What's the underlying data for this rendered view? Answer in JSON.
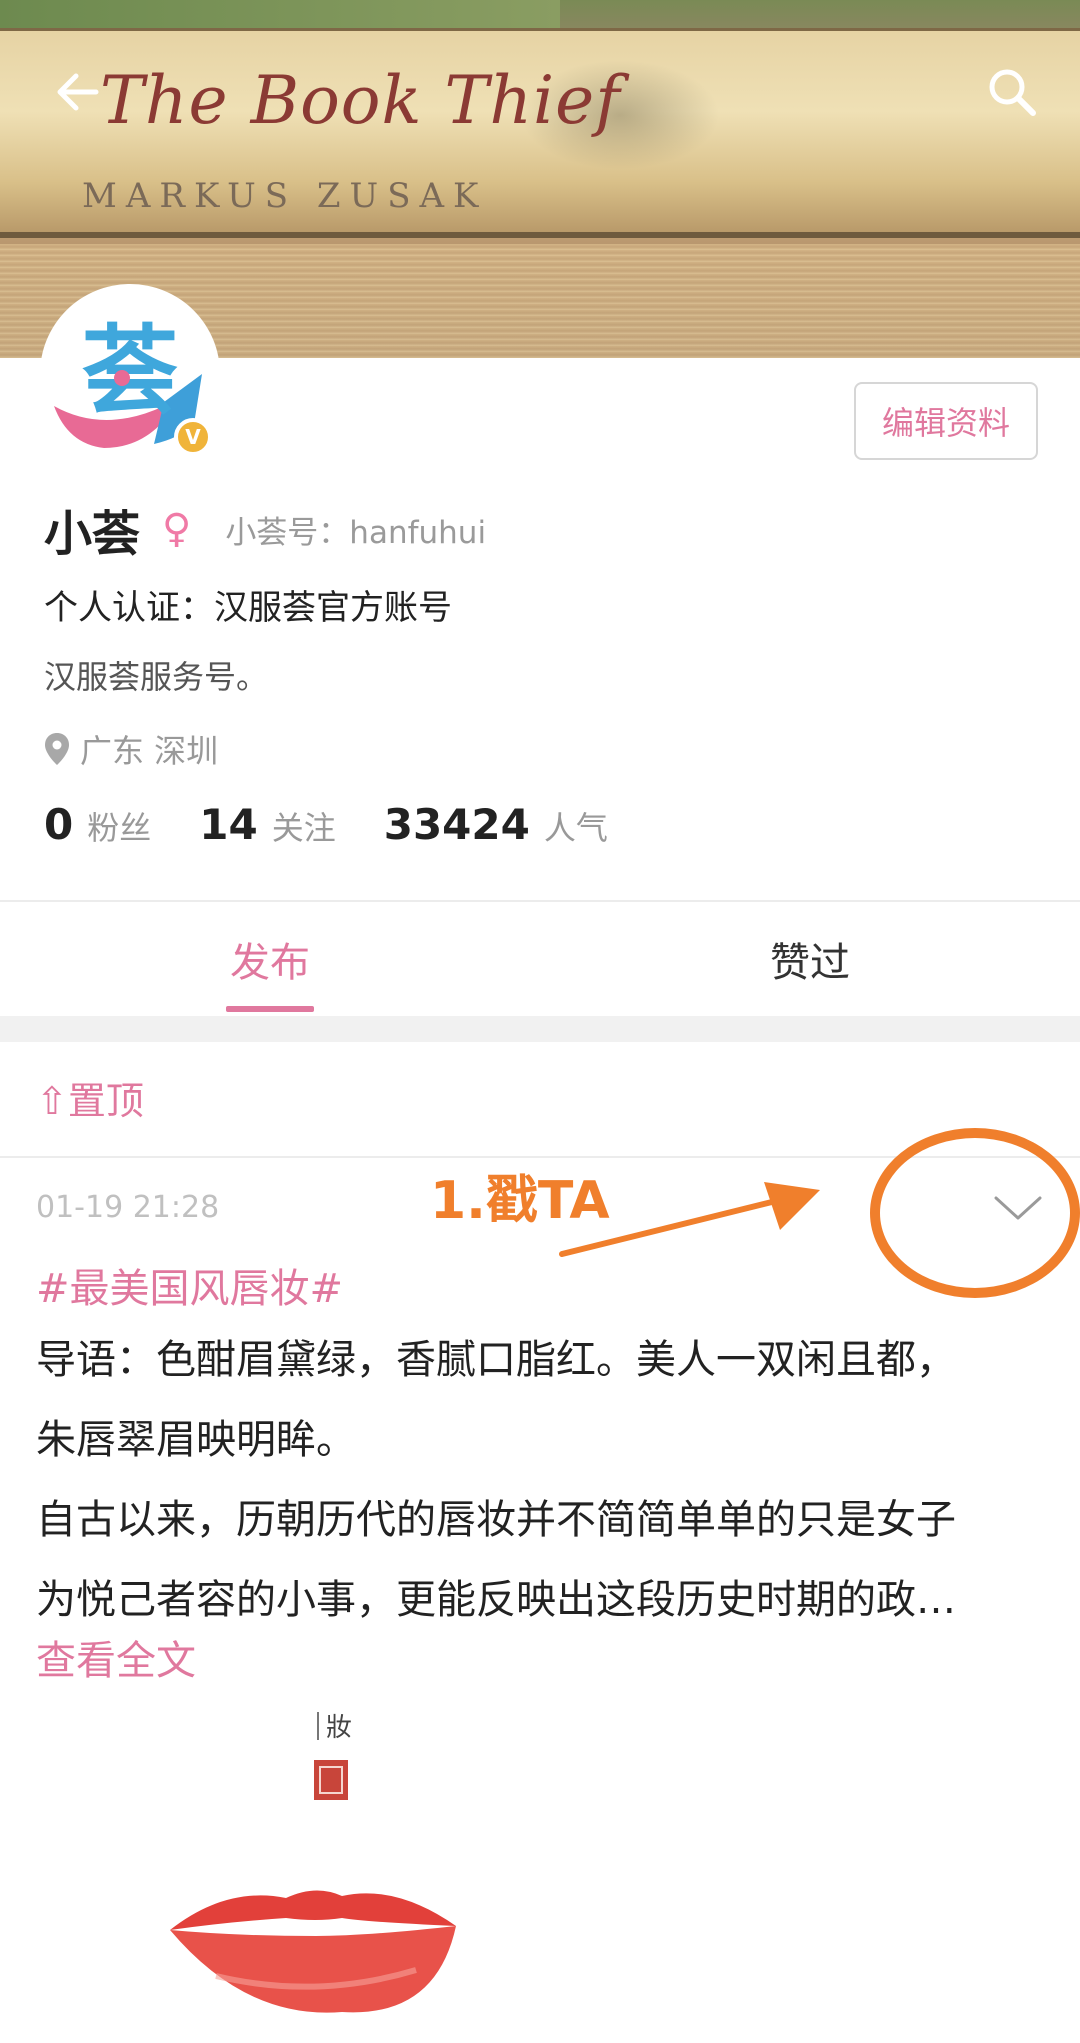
{
  "banner": {
    "book_title": "The Book Thief",
    "book_author": "MARKUS ZUSAK"
  },
  "header": {
    "back_icon": "arrow-left-icon",
    "search_icon": "search-icon"
  },
  "profile": {
    "avatar_char": "荟",
    "verified_mark": "V",
    "edit_label": "编辑资料",
    "name": "小荟",
    "gender_symbol": "♀",
    "user_id": "小荟号：hanfuhui",
    "certification": "个人认证：汉服荟官方账号",
    "bio": "汉服荟服务号。",
    "location": "广东 深圳"
  },
  "stats": [
    {
      "value": "0",
      "label": "粉丝"
    },
    {
      "value": "14",
      "label": "关注"
    },
    {
      "value": "33424",
      "label": "人气"
    }
  ],
  "tabs": [
    {
      "label": "发布",
      "active": true
    },
    {
      "label": "赞过",
      "active": false
    }
  ],
  "pinned_label": "⇧置顶",
  "post": {
    "time": "01-19 21:28",
    "hashtag": "#最美国风唇妆#",
    "line1": "导语：色酣眉黛绿，香腻口脂红。美人一双闲且都，",
    "line2": "朱唇翠眉映明眸。",
    "line3": "自古以来，历朝历代的唇妆并不简简单单的只是女子",
    "line4": "为悦己者容的小事，更能反映出这段历史时期的政…",
    "read_more": "查看全文",
    "image_text": "妝"
  },
  "annotation": {
    "text": "1.戳TA",
    "color": "#f07f2c"
  },
  "colors": {
    "accent": "#e0789e"
  }
}
